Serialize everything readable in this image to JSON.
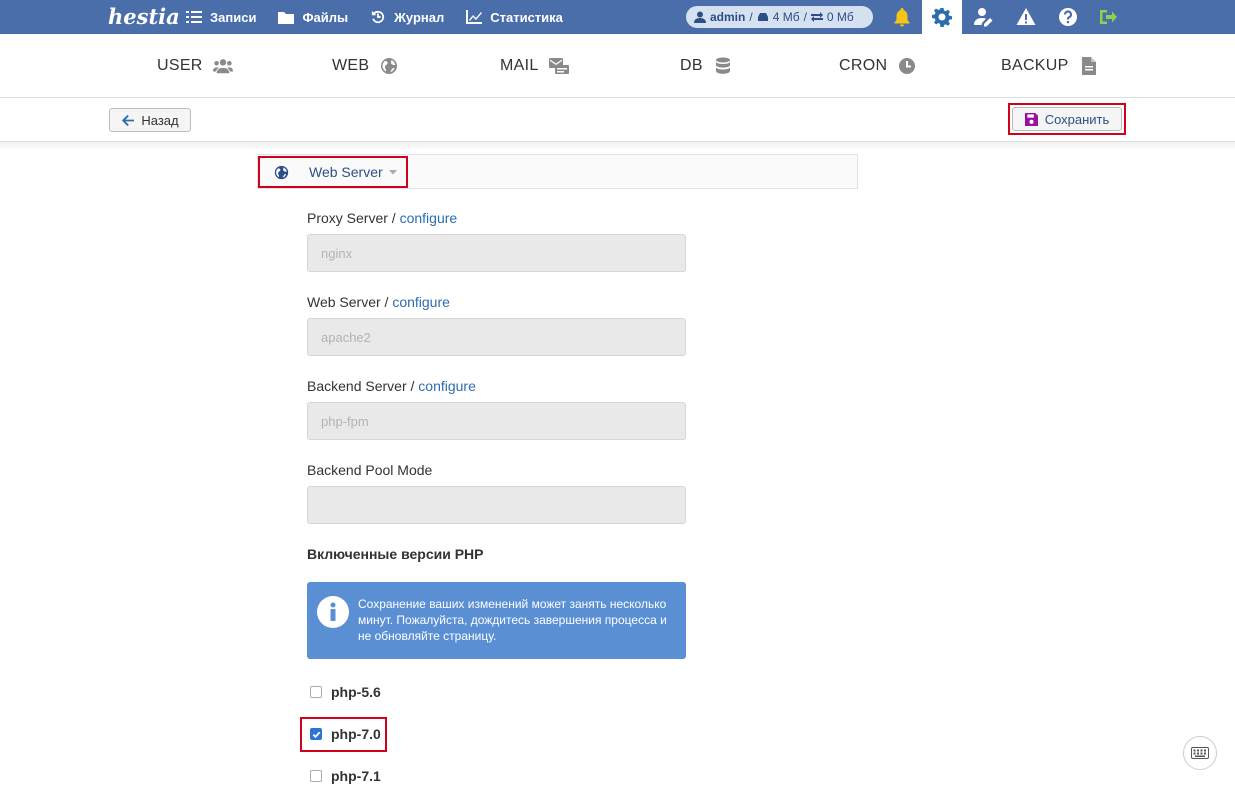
{
  "topbar": {
    "logo": "hestia",
    "nav": [
      {
        "label": "Записи",
        "icon": "list-icon"
      },
      {
        "label": "Файлы",
        "icon": "folder-icon"
      },
      {
        "label": "Журнал",
        "icon": "history-icon"
      },
      {
        "label": "Статистика",
        "icon": "chart-icon"
      }
    ],
    "user": {
      "name": "admin",
      "disk": "4 Мб",
      "bandwidth": "0 Мб"
    },
    "icons": [
      "bell-icon",
      "gear-icon",
      "user-edit-icon",
      "warning-icon",
      "help-icon",
      "logout-icon"
    ],
    "colors": {
      "bar": "#4a6ea9",
      "bell": "#f5c518",
      "logout": "#8fd14f"
    }
  },
  "tabs": [
    {
      "label": "USER",
      "icon": "users-icon"
    },
    {
      "label": "WEB",
      "icon": "globe-icon"
    },
    {
      "label": "MAIL",
      "icon": "mail-icon"
    },
    {
      "label": "DB",
      "icon": "database-icon"
    },
    {
      "label": "CRON",
      "icon": "clock-icon"
    },
    {
      "label": "BACKUP",
      "icon": "file-icon"
    }
  ],
  "toolbar": {
    "back_label": "Назад",
    "save_label": "Сохранить"
  },
  "section": {
    "title": "Web Server"
  },
  "form": {
    "configure_link": "configure",
    "proxy": {
      "label": "Proxy Server /",
      "value": "nginx"
    },
    "web": {
      "label": "Web Server /",
      "value": "apache2"
    },
    "backend": {
      "label": "Backend Server /",
      "value": "php-fpm"
    },
    "pool": {
      "label": "Backend Pool Mode",
      "value": ""
    },
    "php_versions_label": "Включенные версии PHP",
    "alert": "Сохранение ваших изменений может занять несколько минут. Пожалуйста, дождитесь завершения процесса и не обновляйте страницу.",
    "php": [
      {
        "label": "php-5.6",
        "checked": false
      },
      {
        "label": "php-7.0",
        "checked": true
      },
      {
        "label": "php-7.1",
        "checked": false
      }
    ]
  }
}
